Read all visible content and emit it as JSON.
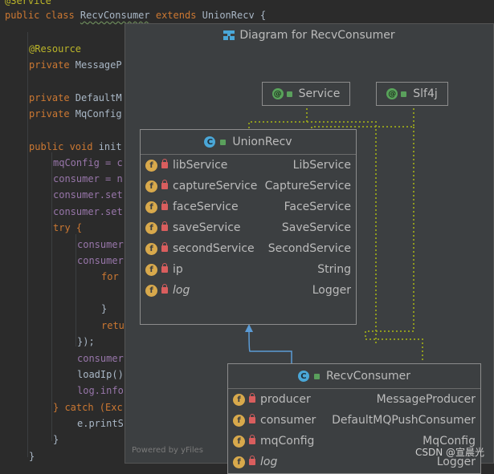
{
  "editor": {
    "lines": [
      {
        "text": "@Service",
        "kind": "ann"
      },
      {
        "text": "public class RecvConsumer extends UnionRecv {",
        "kind": "class"
      },
      {
        "text": "@Resource",
        "kind": "ann"
      },
      {
        "text": "private MessageP",
        "kind": "plain"
      },
      {
        "text": "private DefaultM",
        "kind": "plain"
      },
      {
        "text": "private MqConfig",
        "kind": "plain"
      },
      {
        "text": "public void init",
        "kind": "plain"
      },
      {
        "text": "mqConfig = c",
        "kind": "field"
      },
      {
        "text": "consumer = n",
        "kind": "field"
      },
      {
        "text": "consumer.set",
        "kind": "field"
      },
      {
        "text": "consumer.set",
        "kind": "field"
      },
      {
        "text": "try {",
        "kind": "kw"
      },
      {
        "text": "consumer",
        "kind": "field"
      },
      {
        "text": "consumer",
        "kind": "field"
      },
      {
        "text": "for",
        "kind": "kw"
      },
      {
        "text": "}",
        "kind": "plain"
      },
      {
        "text": "retu",
        "kind": "kw"
      },
      {
        "text": "});",
        "kind": "plain"
      },
      {
        "text": "consumer",
        "kind": "field"
      },
      {
        "text": "loadIp()",
        "kind": "plain"
      },
      {
        "text": "log.info",
        "kind": "field"
      },
      {
        "text": "} catch (Exc",
        "kind": "kw"
      },
      {
        "text": "e.printS",
        "kind": "plain"
      },
      {
        "text": "}",
        "kind": "plain"
      },
      {
        "text": "}",
        "kind": "plain"
      }
    ]
  },
  "popup": {
    "title": "Diagram for RecvConsumer",
    "footer": "Powered by yFiles"
  },
  "nodes": {
    "service": {
      "name": "Service"
    },
    "slf4j": {
      "name": "Slf4j"
    },
    "union": {
      "name": "UnionRecv",
      "fields": [
        {
          "name": "libService",
          "type": "LibService",
          "italic": false
        },
        {
          "name": "captureService",
          "type": "CaptureService",
          "italic": false
        },
        {
          "name": "faceService",
          "type": "FaceService",
          "italic": false
        },
        {
          "name": "saveService",
          "type": "SaveService",
          "italic": false
        },
        {
          "name": "secondService",
          "type": "SecondService",
          "italic": false
        },
        {
          "name": "ip",
          "type": "String",
          "italic": false
        },
        {
          "name": "log",
          "type": "Logger",
          "italic": true
        }
      ]
    },
    "recv": {
      "name": "RecvConsumer",
      "fields": [
        {
          "name": "producer",
          "type": "MessageProducer",
          "italic": false
        },
        {
          "name": "consumer",
          "type": "DefaultMQPushConsumer",
          "italic": false
        },
        {
          "name": "mqConfig",
          "type": "MqConfig",
          "italic": false
        },
        {
          "name": "log",
          "type": "Logger",
          "italic": true
        }
      ]
    }
  },
  "watermark": "CSDN @宣晨光",
  "colors": {
    "accent_blue": "#4aa7d8",
    "field_icon": "#d8a94c",
    "lock": "#d95e5e",
    "annotation_green": "#58a35a",
    "dotted_link": "#8f9a1f",
    "arrow": "#5b9bd5"
  }
}
